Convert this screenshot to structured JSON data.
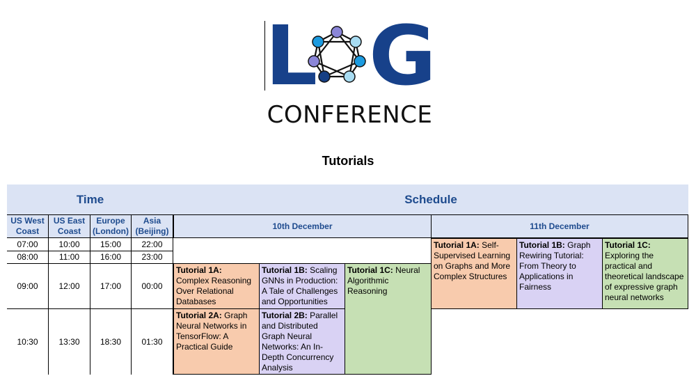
{
  "logo": {
    "letters_left": "L",
    "letters_right": "G",
    "subtitle": "CONFERENCE",
    "colors": {
      "navy": "#17418a",
      "mid_blue": "#1c9be0",
      "light_blue": "#a8dcf2",
      "purple": "#8b86d8",
      "dark_blue": "#163f84"
    }
  },
  "page_title": "Tutorials",
  "table": {
    "time_header": "Time",
    "schedule_header": "Schedule",
    "zones": [
      {
        "name": "US West Coast"
      },
      {
        "name": "US East Coast"
      },
      {
        "name": "Europe (London)"
      },
      {
        "name": "Asia (Beijing)"
      }
    ],
    "days": [
      "10th December",
      "11th December"
    ],
    "rows": [
      [
        "07:00",
        "10:00",
        "15:00",
        "22:00"
      ],
      [
        "08:00",
        "11:00",
        "16:00",
        "23:00"
      ],
      [
        "09:00",
        "12:00",
        "17:00",
        "00:00"
      ],
      [
        "10:30",
        "13:30",
        "18:30",
        "01:30"
      ]
    ],
    "tutorials": {
      "t1a": {
        "code": "Tutorial 1A:",
        "title": "Complex Reasoning Over Relational Databases"
      },
      "t1b": {
        "code": "Tutorial 1B:",
        "title": "Scaling GNNs in Production: A Tale of Challenges and Opportunities"
      },
      "t1c": {
        "code": "Tutorial 1C:",
        "title": "Neural Algorithmic Reasoning"
      },
      "t2a": {
        "code": "Tutorial 2A:",
        "title": "Graph Neural Networks in TensorFlow: A Practical Guide"
      },
      "t2b": {
        "code": "Tutorial 2B:",
        "title": "Parallel and Distributed Graph Neural Networks: An In-Depth Concurrency Analysis"
      },
      "d2_1a": {
        "code": "Tutorial 1A:",
        "title": "Self-Supervised Learning on Graphs and More Complex Structures"
      },
      "d2_1b": {
        "code": "Tutorial 1B:",
        "title": "Graph Rewiring Tutorial: From Theory to Applications in Fairness"
      },
      "d2_1c": {
        "code": "Tutorial 1C:",
        "title": "Exploring the practical and theoretical landscape of expressive graph neural networks"
      }
    },
    "colors": {
      "header_bg": "#dbe3f4",
      "header_text": "#1e4b8e",
      "peach": "#f8cbad",
      "lavender": "#d9d2f4",
      "green": "#c6e0b4"
    }
  }
}
